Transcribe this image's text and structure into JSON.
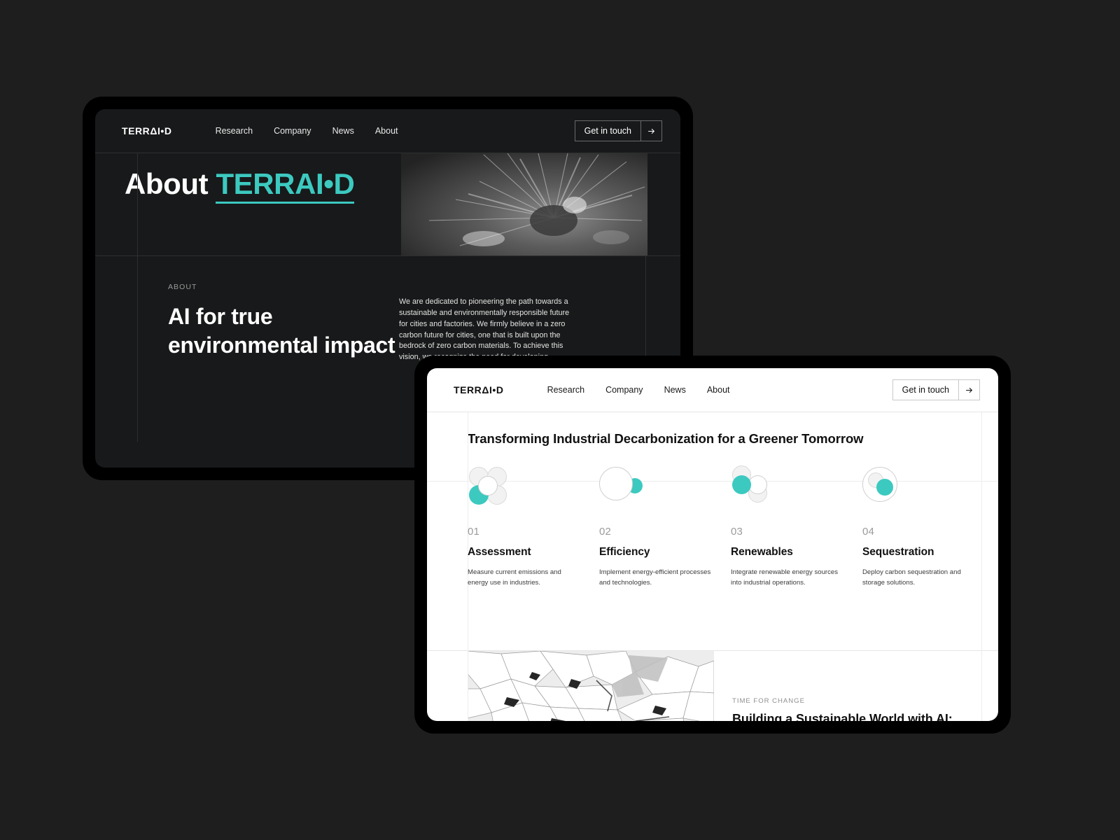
{
  "brand": {
    "logo": "TERRΔI•D",
    "accent_color": "#3cc9c0"
  },
  "dark_window": {
    "nav": {
      "logo": "TERRΔI•D",
      "links": [
        {
          "label": "Research"
        },
        {
          "label": "Company"
        },
        {
          "label": "News"
        },
        {
          "label": "About"
        }
      ],
      "cta_label": "Get in touch",
      "cta_icon": "arrow-right-icon"
    },
    "hero": {
      "title_prefix": "About ",
      "title_accent": "TERRAI•D"
    },
    "about": {
      "eyebrow": "ABOUT",
      "heading": "AI for true environmental impact",
      "body": "We are dedicated to pioneering the path towards a sustainable and environmentally responsible future for cities and factories. We firmly believe in a zero carbon future for cities, one that is built upon the bedrock of zero carbon materials. To achieve this vision, we recognize the need for developing"
    }
  },
  "light_window": {
    "nav": {
      "logo": "TERRΔI•D",
      "links": [
        {
          "label": "Research"
        },
        {
          "label": "Company"
        },
        {
          "label": "News"
        },
        {
          "label": "About"
        }
      ],
      "cta_label": "Get in touch",
      "cta_icon": "arrow-right-icon"
    },
    "section_heading": "Transforming Industrial Decarbonization for a Greener Tomorrow",
    "steps": [
      {
        "number": "01",
        "title": "Assessment",
        "description": "Measure current emissions and energy use in industries.",
        "icon": "four-circle-cluster-icon"
      },
      {
        "number": "02",
        "title": "Efficiency",
        "description": "Implement energy-efficient processes and technologies.",
        "icon": "large-circle-with-teal-dot-icon"
      },
      {
        "number": "03",
        "title": "Renewables",
        "description": "Integrate renewable energy sources into industrial operations.",
        "icon": "stacked-circles-icon"
      },
      {
        "number": "04",
        "title": "Sequestration",
        "description": "Deploy carbon sequestration and storage solutions.",
        "icon": "circle-in-circle-icon"
      }
    ],
    "bottom": {
      "eyebrow": "TIME FOR CHANGE",
      "heading": "Building a Sustainable World with AI:"
    }
  }
}
